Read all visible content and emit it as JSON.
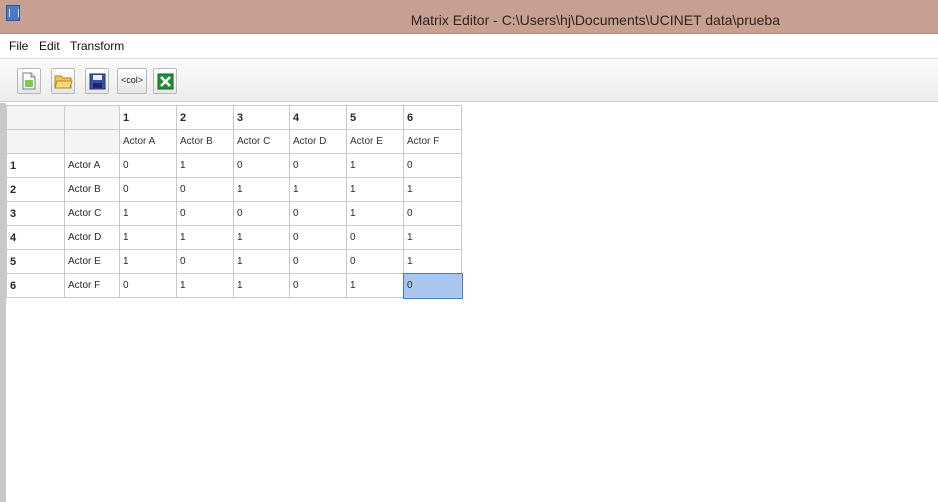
{
  "window": {
    "title": "Matrix Editor - C:\\Users\\hj\\Documents\\UCINET data\\prueba"
  },
  "menu": [
    "File",
    "Edit",
    "Transform"
  ],
  "toolbar": {
    "buttons": [
      {
        "name": "new-icon",
        "label": ""
      },
      {
        "name": "open-folder-icon",
        "label": ""
      },
      {
        "name": "save-disk-icon",
        "label": ""
      },
      {
        "name": "column-labels-button",
        "label": "<col>"
      },
      {
        "name": "excel-icon",
        "label": ""
      }
    ]
  },
  "matrix": {
    "column_numbers": [
      "1",
      "2",
      "3",
      "4",
      "5",
      "6"
    ],
    "column_labels": [
      "Actor A",
      "Actor B",
      "Actor C",
      "Actor D",
      "Actor E",
      "Actor F"
    ],
    "rows": [
      {
        "num": "1",
        "label": "Actor A",
        "cells": [
          "0",
          "1",
          "0",
          "0",
          "1",
          "0"
        ]
      },
      {
        "num": "2",
        "label": "Actor B",
        "cells": [
          "0",
          "0",
          "1",
          "1",
          "1",
          "1"
        ]
      },
      {
        "num": "3",
        "label": "Actor C",
        "cells": [
          "1",
          "0",
          "0",
          "0",
          "1",
          "0"
        ]
      },
      {
        "num": "4",
        "label": "Actor D",
        "cells": [
          "1",
          "1",
          "1",
          "0",
          "0",
          "1"
        ]
      },
      {
        "num": "5",
        "label": "Actor E",
        "cells": [
          "1",
          "0",
          "1",
          "0",
          "0",
          "1"
        ]
      },
      {
        "num": "6",
        "label": "Actor F",
        "cells": [
          "0",
          "1",
          "1",
          "0",
          "1",
          "0"
        ]
      }
    ]
  },
  "colors": {
    "titlebar": "#c8a091",
    "selected_cell": "#a9c6ec"
  }
}
